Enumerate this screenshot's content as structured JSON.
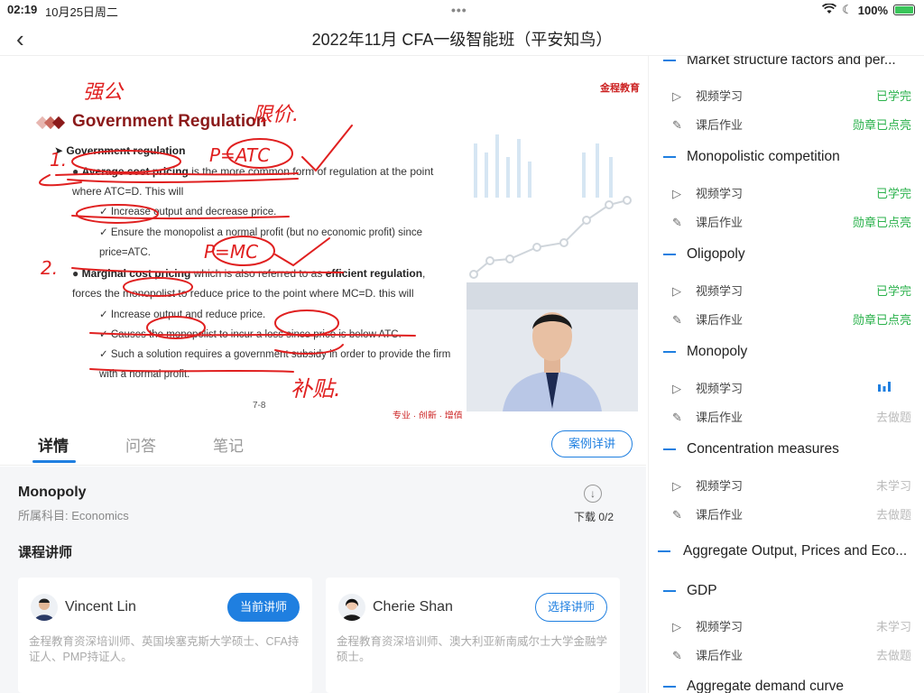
{
  "status_bar": {
    "time": "02:19",
    "date": "10月25日周二",
    "battery": "100%"
  },
  "header": {
    "title": "2022年11月 CFA一级智能班（平安知鸟）"
  },
  "slide": {
    "brand": "金程教育",
    "title": "Government Regulation",
    "subtitle": "Government regulation",
    "bullet1_bold": "Average cost pricing",
    "bullet1_rest": "is the more common form of regulation at the point where ATC=D. This will",
    "check1": "Increase output and decrease price.",
    "check2": "Ensure the monopolist a normal profit (but no economic profit) since price=ATC.",
    "bullet2_bold": "Marginal cost pricing",
    "bullet2_mid": "which is also referred to as",
    "bullet2_bold2": "efficient regulation",
    "bullet2_rest": ", forces the monopolist to reduce price to the point where MC=D. this will",
    "check3": "Increase output and reduce price.",
    "check4": "Causes the monopolist to incur a loss since price is below ATC.",
    "check5": "Such a solution requires a government subsidy in order to provide the firm with a normal profit.",
    "page": "7-8",
    "motto": "专业 · 创新 · 增值",
    "annotations": {
      "a1": "强公",
      "a2": "限价.",
      "a3": "P=ATC",
      "a4": "P=MC",
      "a5": "补贴.",
      "n1": "1.",
      "n2": "2."
    }
  },
  "tabs": [
    {
      "label": "详情"
    },
    {
      "label": "问答"
    },
    {
      "label": "笔记"
    }
  ],
  "case_button": "案例详讲",
  "detail": {
    "course_name": "Monopoly",
    "subject": "所属科目:  Economics",
    "download": "下载 0/2",
    "teacher_heading": "课程讲师",
    "teachers": [
      {
        "name": "Vincent Lin",
        "button": "当前讲师",
        "desc": "金程教育资深培训师、英国埃塞克斯大学硕士、CFA持证人、PMP持证人。"
      },
      {
        "name": "Cherie Shan",
        "button": "选择讲师",
        "desc": "金程教育资深培训师、澳大利亚新南威尔士大学金融学硕士。"
      }
    ]
  },
  "sidebar": {
    "sections": [
      {
        "title": "Market structure factors and per...",
        "video": "视频学习",
        "video_status": "已学完",
        "hw": "课后作业",
        "hw_status": "勋章已点亮"
      },
      {
        "title": "Monopolistic competition",
        "video": "视频学习",
        "video_status": "已学完",
        "hw": "课后作业",
        "hw_status": "勋章已点亮"
      },
      {
        "title": "Oligopoly",
        "video": "视频学习",
        "video_status": "已学完",
        "hw": "课后作业",
        "hw_status": "勋章已点亮"
      },
      {
        "title": "Monopoly",
        "video": "视频学习",
        "video_status": "",
        "hw": "课后作业",
        "hw_status": "去做题"
      },
      {
        "title": "Concentration measures",
        "video": "视频学习",
        "video_status": "未学习",
        "hw": "课后作业",
        "hw_status": "去做题"
      }
    ],
    "chapter": "Aggregate Output, Prices and Eco...",
    "sections2": [
      {
        "title": "GDP",
        "video": "视频学习",
        "video_status": "未学习",
        "hw": "课后作业",
        "hw_status": "去做题"
      },
      {
        "title": "Aggregate demand curve"
      }
    ]
  }
}
